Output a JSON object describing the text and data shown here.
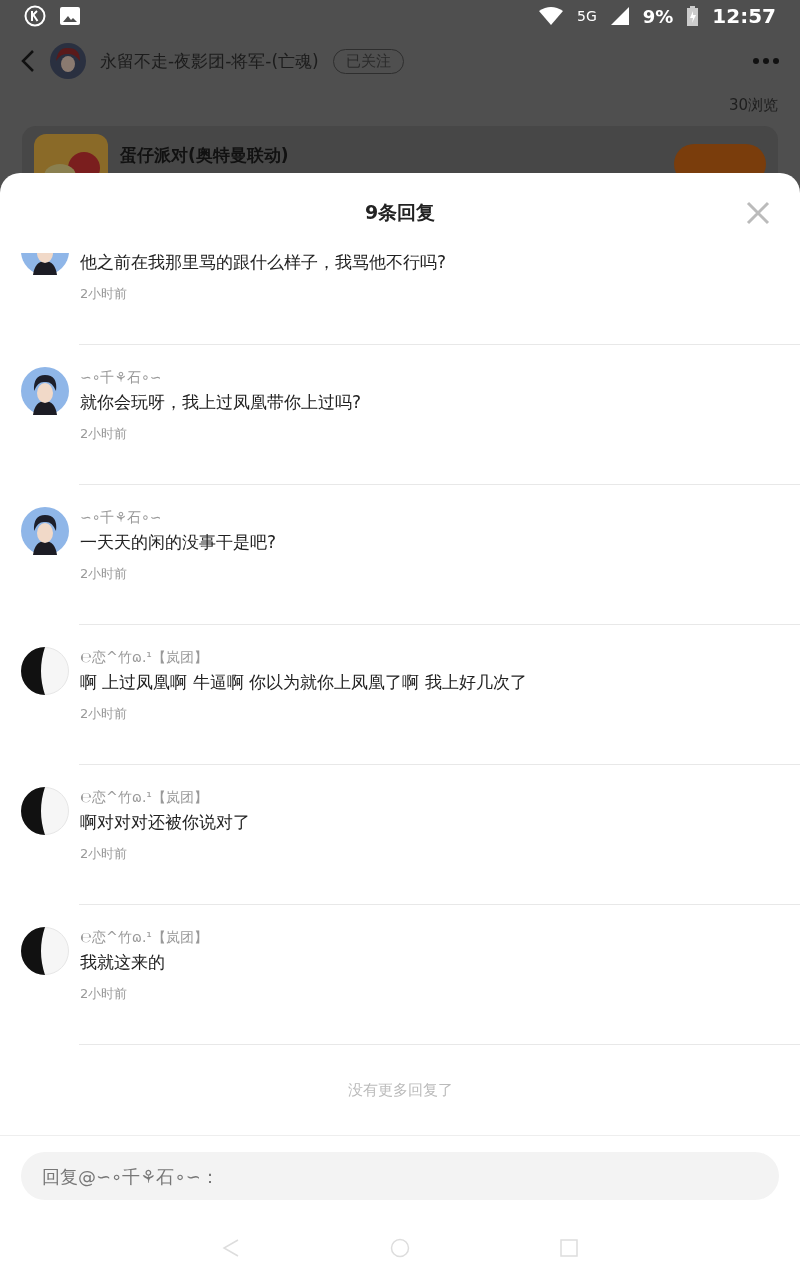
{
  "status_bar": {
    "signal": "5G",
    "battery": "9%",
    "time": "12:57"
  },
  "post_header": {
    "author": "永留不走-夜影团-将军-(亡魂)",
    "follow": "已关注",
    "views": "30浏览"
  },
  "game_card": {
    "title": "蛋仔派对(奥特曼联动)"
  },
  "sheet": {
    "title": "9条回复",
    "replies": [
      {
        "kind": "boy",
        "text": "他之前在我那里骂的跟什么样子，我骂他不行吗?",
        "time": "2小时前"
      },
      {
        "kind": "boy",
        "name": "∽∘千⚘石∘∽",
        "text": "就你会玩呀，我上过凤凰带你上过吗?",
        "time": "2小时前"
      },
      {
        "kind": "boy",
        "name": "∽∘千⚘石∘∽",
        "text": "一天天的闲的没事干是吧?",
        "time": "2小时前"
      },
      {
        "kind": "moon",
        "name": "℮恋^竹ɷ.¹【岚团】",
        "text": "啊 上过凤凰啊 牛逼啊 你以为就你上凤凰了啊 我上好几次了",
        "time": "2小时前"
      },
      {
        "kind": "moon",
        "name": "℮恋^竹ɷ.¹【岚团】",
        "text": "啊对对对还被你说对了",
        "time": "2小时前"
      },
      {
        "kind": "moon",
        "name": "℮恋^竹ɷ.¹【岚团】",
        "text": "我就这来的",
        "time": "2小时前"
      }
    ],
    "end_note": "没有更多回复了",
    "reply_field": {
      "placeholder": "回复@∽∘千⚘石∘∽："
    }
  }
}
